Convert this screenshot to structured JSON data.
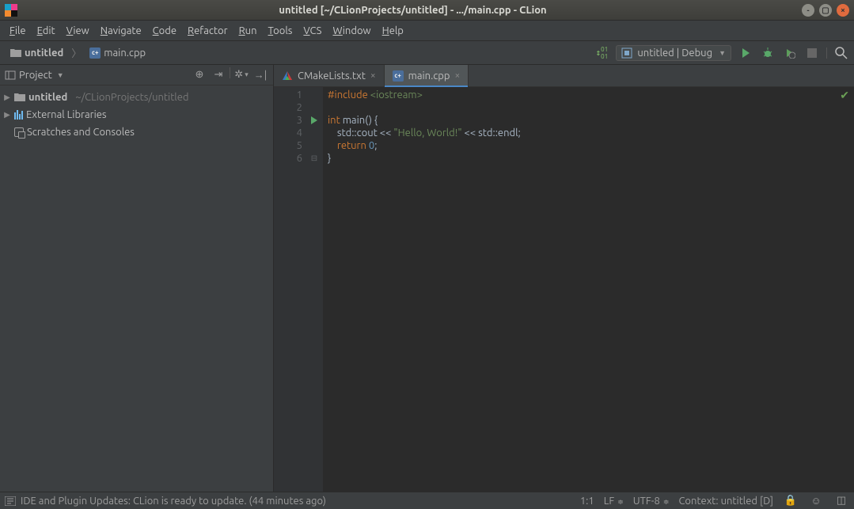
{
  "titlebar": {
    "title": "untitled [~/CLionProjects/untitled] - .../main.cpp - CLion"
  },
  "menu": [
    "File",
    "Edit",
    "View",
    "Navigate",
    "Code",
    "Refactor",
    "Run",
    "Tools",
    "VCS",
    "Window",
    "Help"
  ],
  "breadcrumbs": {
    "project": "untitled",
    "file": "main.cpp"
  },
  "run_config": {
    "label": "untitled | Debug"
  },
  "project_tool": {
    "title": "Project"
  },
  "tree": {
    "root": {
      "name": "untitled",
      "hint": "~/CLionProjects/untitled"
    },
    "external": "External Libraries",
    "scratches": "Scratches and Consoles"
  },
  "tabs": [
    {
      "name": "CMakeLists.txt",
      "active": false
    },
    {
      "name": "main.cpp",
      "active": true
    }
  ],
  "code": {
    "lines": [
      {
        "n": 1,
        "html": "<span class='inc'>#include</span> <span class='hdr'>&lt;iostream&gt;</span>"
      },
      {
        "n": 2,
        "html": ""
      },
      {
        "n": 3,
        "html": "<span class='kw'>int</span> <span class='ns'>main</span>() {",
        "run": true,
        "fold": "open"
      },
      {
        "n": 4,
        "html": "    std::cout &lt;&lt; <span class='str'>\"Hello, World!\"</span> &lt;&lt; std::endl;"
      },
      {
        "n": 5,
        "html": "    <span class='kw'>return</span> <span class='num'>0</span>;"
      },
      {
        "n": 6,
        "html": "}",
        "fold": "close"
      }
    ]
  },
  "status": {
    "message": "IDE and Plugin Updates: CLion is ready to update. (44 minutes ago)",
    "caret": "1:1",
    "lineend": "LF",
    "encoding": "UTF-8",
    "context": "Context: untitled [D]"
  }
}
